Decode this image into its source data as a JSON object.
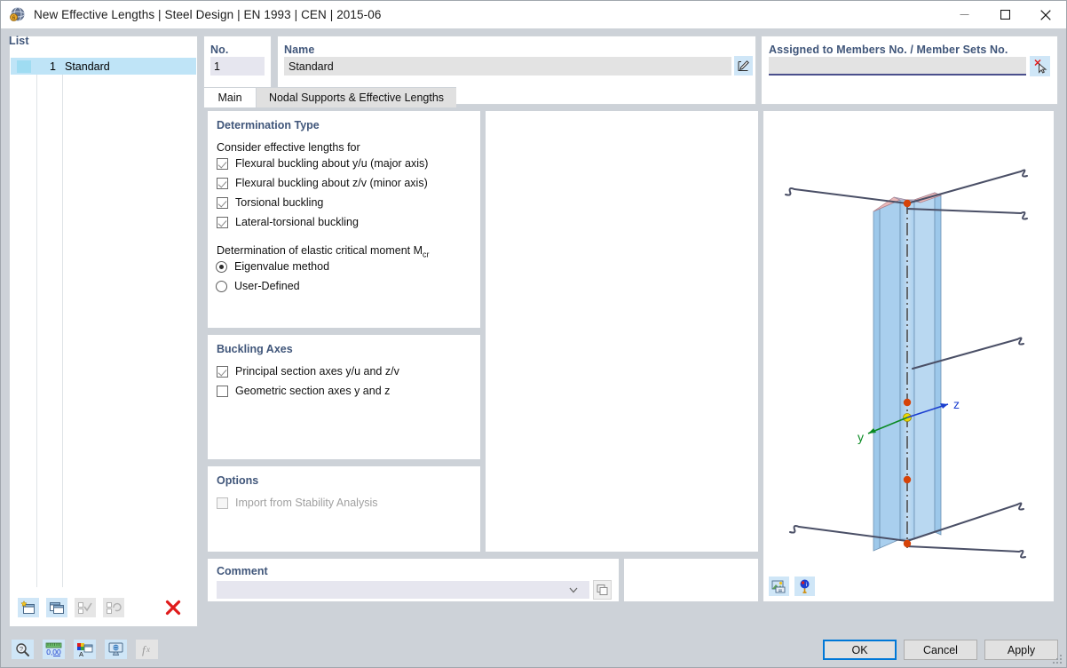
{
  "window": {
    "title": "New Effective Lengths | Steel Design | EN 1993 | CEN | 2015-06",
    "app_icon": "rfem-globe-icon",
    "minimize": "—",
    "maximize": "□",
    "close": "✕"
  },
  "list": {
    "header": "List",
    "rows": [
      {
        "no": "1",
        "name": "Standard",
        "swatch": "#9fdcf2",
        "selected": true
      }
    ],
    "toolbar": [
      {
        "name": "new-entry-button",
        "icon": "new-window-star-icon",
        "enabled": true
      },
      {
        "name": "copy-entry-button",
        "icon": "copy-window-icon",
        "enabled": true
      },
      {
        "name": "check-entries-button",
        "icon": "checklist-icon",
        "enabled": false
      },
      {
        "name": "reset-entries-button",
        "icon": "checklist-reset-icon",
        "enabled": false
      },
      {
        "name": "delete-entry-button",
        "icon": "red-x-icon",
        "enabled": true
      }
    ]
  },
  "no_field": {
    "label": "No.",
    "value": "1"
  },
  "name_field": {
    "label": "Name",
    "value": "Standard",
    "edit_icon": "edit-pencil-icon"
  },
  "assigned": {
    "label": "Assigned to Members No. / Member Sets No.",
    "value": "",
    "pick_icon": "select-objects-cursor-icon"
  },
  "tabs": [
    {
      "label": "Main",
      "active": true
    },
    {
      "label": "Nodal Supports & Effective Lengths",
      "active": false
    }
  ],
  "determination": {
    "title": "Determination Type",
    "consider_label": "Consider effective lengths for",
    "checks": [
      {
        "label": "Flexural buckling about y/u (major axis)",
        "checked": true
      },
      {
        "label": "Flexural buckling about z/v (minor axis)",
        "checked": true
      },
      {
        "label": "Torsional buckling",
        "checked": true
      },
      {
        "label": "Lateral-torsional buckling",
        "checked": true
      }
    ],
    "mcr_label_main": "Determination of elastic critical moment M",
    "mcr_label_sub": "cr",
    "radios": [
      {
        "label": "Eigenvalue method",
        "selected": true
      },
      {
        "label": "User-Defined",
        "selected": false
      }
    ]
  },
  "buckling_axes": {
    "title": "Buckling Axes",
    "checks": [
      {
        "label": "Principal section axes y/u and z/v",
        "checked": true
      },
      {
        "label": "Geometric section axes y and z",
        "checked": false
      }
    ]
  },
  "options": {
    "title": "Options",
    "checks": [
      {
        "label": "Import from Stability Analysis",
        "checked": false,
        "disabled": true
      }
    ]
  },
  "comment": {
    "label": "Comment",
    "value": "",
    "dropdown_icon": "chevron-down-icon",
    "copy_icon": "copy-comment-icon"
  },
  "viewport": {
    "axis_y_label": "y",
    "axis_z_label": "z",
    "axis_y_color": "#0a8a23",
    "axis_z_color": "#1b3fd0",
    "member_fill": "#aed2ee",
    "node_color": "#d64309",
    "origin_color": "#f0d800",
    "toolbar": [
      {
        "name": "render-mode-button",
        "icon": "image-render-icon"
      },
      {
        "name": "view-info-button",
        "icon": "info-balloon-icon"
      }
    ]
  },
  "footer": {
    "tools": [
      {
        "name": "search-button",
        "icon": "magnifier-icon",
        "enabled": true
      },
      {
        "name": "units-button",
        "icon": "units-decimal-icon",
        "enabled": true
      },
      {
        "name": "colors-button",
        "icon": "colors-legend-icon",
        "enabled": true
      },
      {
        "name": "display-button",
        "icon": "display-monitor-icon",
        "enabled": true
      },
      {
        "name": "formula-button",
        "icon": "formula-fx-icon",
        "enabled": false
      }
    ],
    "buttons": [
      {
        "label": "OK",
        "name": "ok-button",
        "primary": true
      },
      {
        "label": "Cancel",
        "name": "cancel-button",
        "primary": false
      },
      {
        "label": "Apply",
        "name": "apply-button",
        "primary": false
      }
    ]
  }
}
